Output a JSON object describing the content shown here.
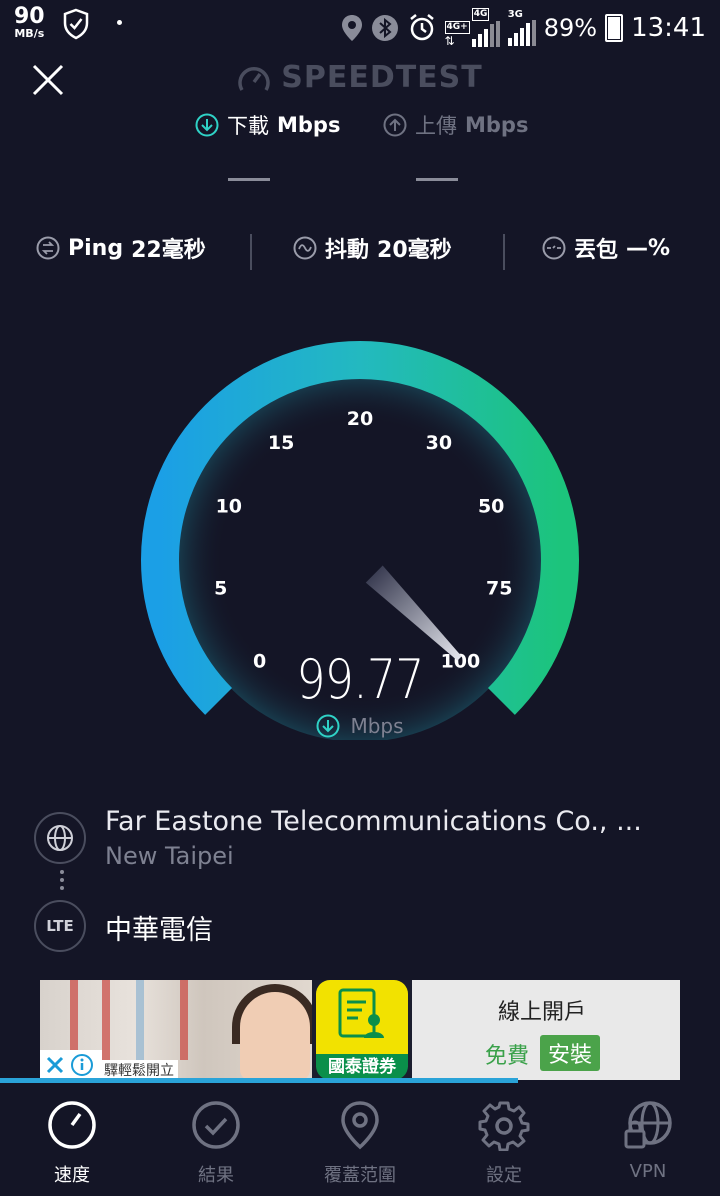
{
  "status_bar": {
    "net_speed": "90",
    "net_speed_unit": "MB/s",
    "battery": "89%",
    "time": "13:41",
    "sim1_tag": "4G+",
    "sim1_network": "4G",
    "sim2_network": "3G",
    "icons": [
      "shield-check-icon",
      "location-icon",
      "bluetooth-icon",
      "alarm-icon",
      "signal-icon",
      "battery-icon"
    ]
  },
  "header": {
    "title": "SPEEDTEST",
    "download_tab": "下載",
    "upload_tab": "上傳",
    "unit": "Mbps",
    "download_value": "—",
    "upload_value": "—"
  },
  "metrics": {
    "ping_label": "Ping",
    "ping_value": "22毫秒",
    "jitter_label": "抖動",
    "jitter_value": "20毫秒",
    "loss_label": "丟包",
    "loss_value": "—%"
  },
  "gauge": {
    "ticks": [
      "0",
      "5",
      "10",
      "15",
      "20",
      "30",
      "50",
      "75",
      "100"
    ],
    "reading": "99.77",
    "unit": "Mbps",
    "needle_value": 99.77,
    "accent_start": "#1ea0e3",
    "accent_end": "#1cc47c"
  },
  "provider": {
    "isp": "Far Eastone Telecommunications Co., ...",
    "city": "New Taipei",
    "network_type": "LTE",
    "carrier": "中華電信"
  },
  "ad": {
    "headline": "線上開戶",
    "free": "免費",
    "install": "安裝",
    "brand": "國泰證券",
    "caption": "驛輕鬆開立"
  },
  "progress_fraction": 0.72,
  "nav": {
    "items": [
      {
        "label": "速度",
        "icon": "speedometer-icon",
        "active": true
      },
      {
        "label": "結果",
        "icon": "check-circle-icon",
        "active": false
      },
      {
        "label": "覆蓋范圍",
        "icon": "map-pin-icon",
        "active": false
      },
      {
        "label": "設定",
        "icon": "gear-icon",
        "active": false
      },
      {
        "label": "VPN",
        "icon": "vpn-globe-lock-icon",
        "active": false
      }
    ]
  }
}
